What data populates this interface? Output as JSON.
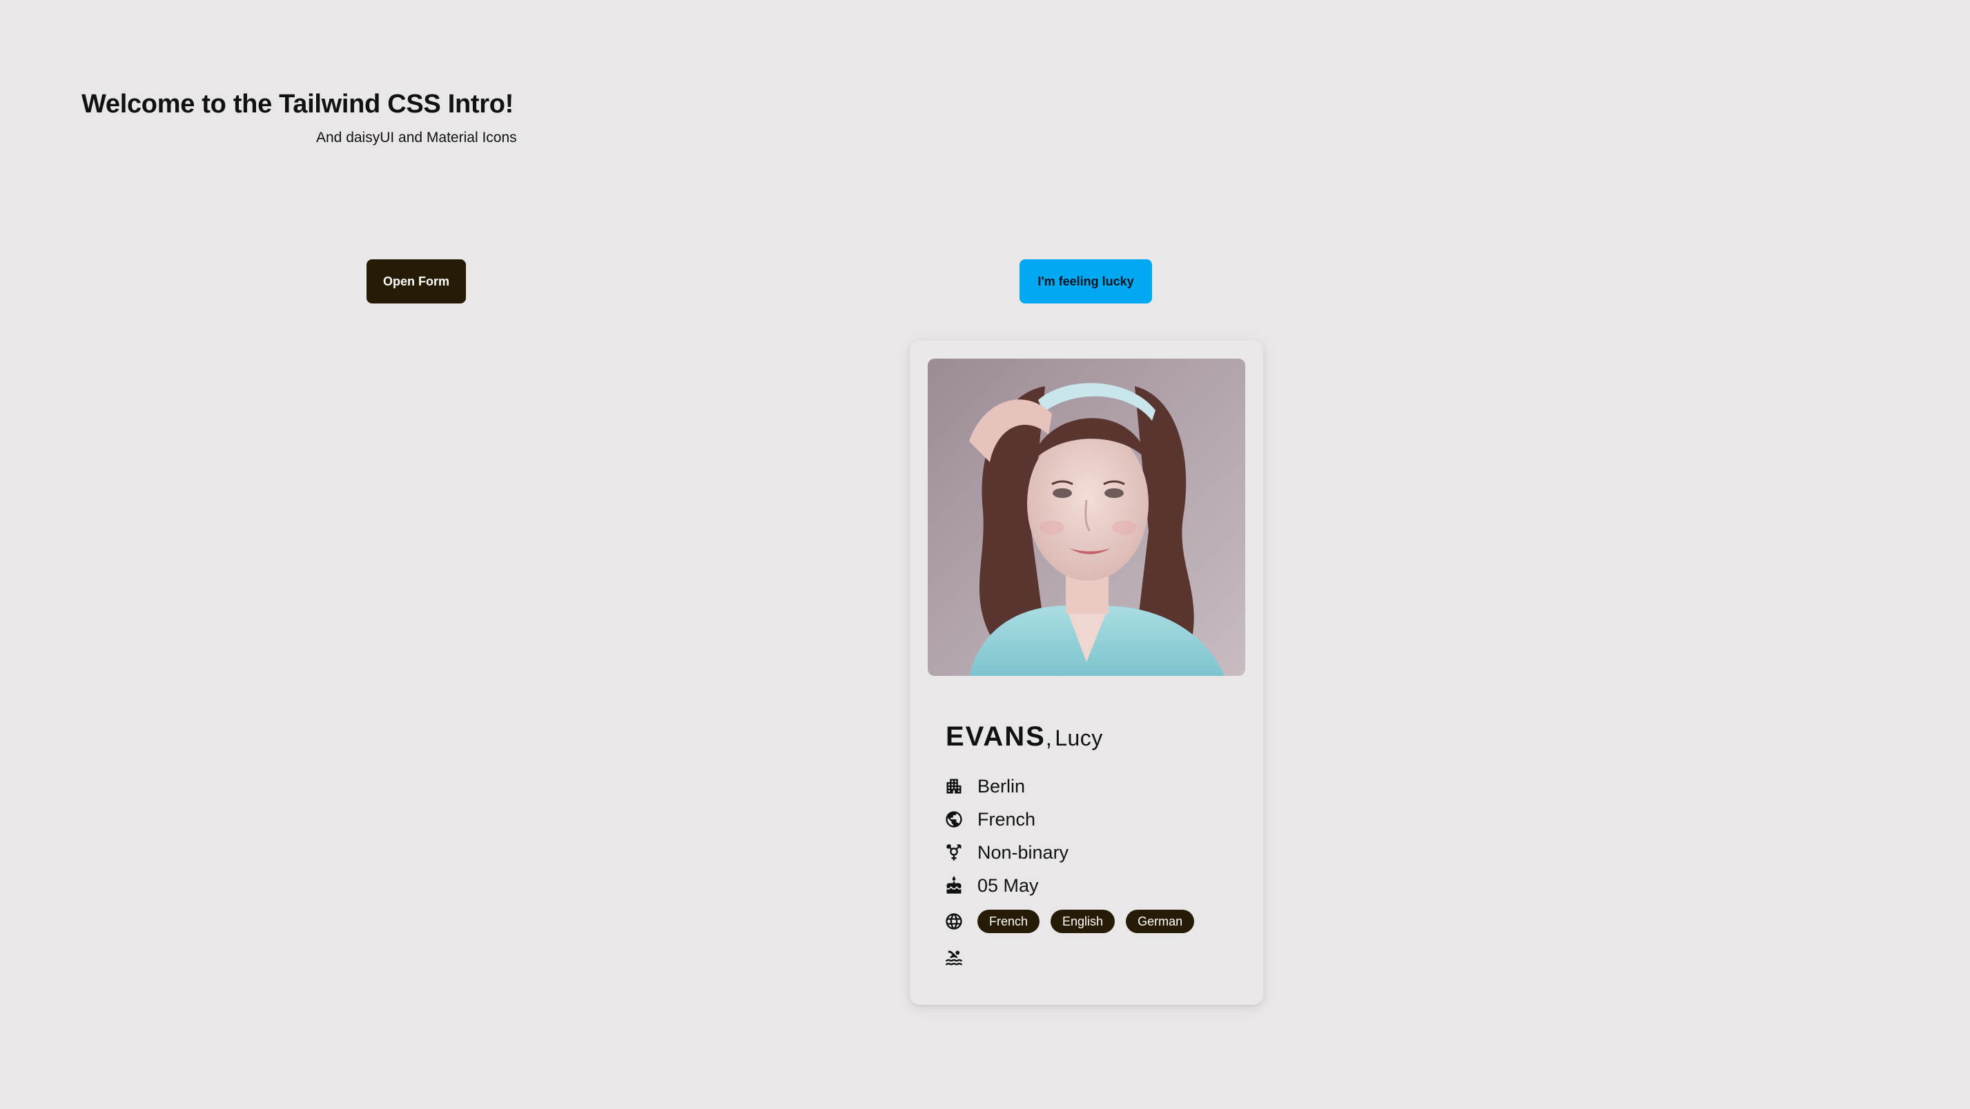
{
  "header": {
    "title": "Welcome to the Tailwind CSS Intro!",
    "subtitle": "And daisyUI and Material Icons"
  },
  "buttons": {
    "open_form": "Open Form",
    "feeling_lucky": "I'm feeling lucky"
  },
  "profile": {
    "surname": "EVANS",
    "separator": ",",
    "first_name": "Lucy",
    "city": "Berlin",
    "nationality": "French",
    "gender": "Non-binary",
    "birthday": "05 May",
    "languages": [
      "French",
      "English",
      "German"
    ],
    "hobbies": []
  },
  "icons": {
    "city": "apartment-icon",
    "nationality": "public-icon",
    "gender": "transgender-icon",
    "birthday": "cake-icon",
    "languages": "language-icon",
    "hobbies": "pool-icon"
  },
  "colors": {
    "background": "#e9e7e8",
    "primary_dark": "#261c06",
    "accent_blue": "#00a9f1"
  }
}
